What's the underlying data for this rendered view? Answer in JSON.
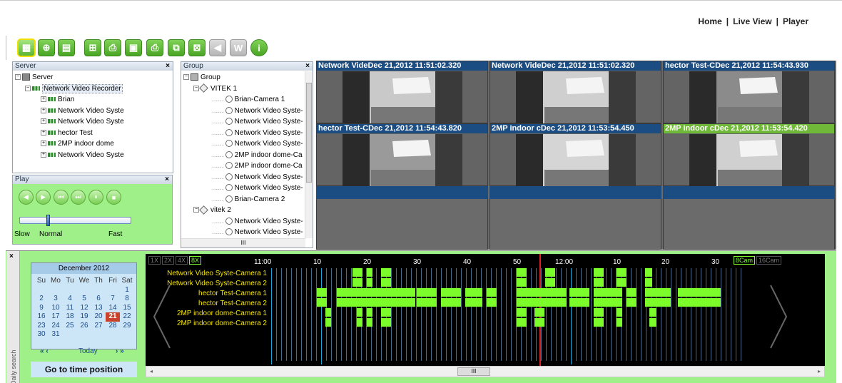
{
  "nav": {
    "home": "Home",
    "live": "Live View",
    "player": "Player",
    "sep": "|"
  },
  "server_panel": {
    "title": "Server",
    "close": "×",
    "root": "Server",
    "nvr": "Network Video Recorder",
    "children": [
      "Brian",
      "Network Video Syste",
      "Network Video Syste",
      "hector Test",
      "2MP indoor dome",
      "Network Video Syste"
    ]
  },
  "group_panel": {
    "title": "Group",
    "close": "×",
    "root": "Group",
    "group1": "VITEK 1",
    "cams1": [
      "Brian-Camera 1",
      "Network Video Syste-",
      "Network Video Syste-",
      "Network Video Syste-",
      "Network Video Syste-",
      "2MP indoor dome-Ca",
      "2MP indoor dome-Ca",
      "Network Video Syste-",
      "Network Video Syste-",
      "Brian-Camera 2"
    ],
    "group2": "vitek 2",
    "cams2": [
      "Network Video Syste-",
      "Network Video Syste-"
    ],
    "scroll": "III"
  },
  "play_panel": {
    "title": "Play",
    "close": "×",
    "slow": "Slow",
    "normal": "Normal",
    "fast": "Fast",
    "speed_level": 0.25
  },
  "cameras": [
    {
      "title": "Network VideDec 21,2012 11:51:02.320",
      "active": false
    },
    {
      "title": "Network VideDec 21,2012 11:51:02.320",
      "active": false
    },
    {
      "title": "hector Test-CDec 21,2012 11:54:43.930",
      "active": false
    },
    {
      "title": "hector Test-CDec 21,2012 11:54:43.820",
      "active": false
    },
    {
      "title": "2MP indoor cDec 21,2012 11:53:54.450",
      "active": false
    },
    {
      "title": "2MP indoor cDec 21,2012 11:53:54.420",
      "active": true
    }
  ],
  "calendar": {
    "month": "December 2012",
    "weekdays": [
      "Su",
      "Mo",
      "Tu",
      "We",
      "Th",
      "Fri",
      "Sat"
    ],
    "weeks": [
      [
        "",
        "",
        "",
        "",
        "",
        "",
        "1"
      ],
      [
        "2",
        "3",
        "4",
        "5",
        "6",
        "7",
        "8"
      ],
      [
        "9",
        "10",
        "11",
        "12",
        "13",
        "14",
        "15"
      ],
      [
        "16",
        "17",
        "18",
        "19",
        "20",
        "21",
        "22"
      ],
      [
        "23",
        "24",
        "25",
        "26",
        "27",
        "28",
        "29"
      ],
      [
        "30",
        "31",
        "",
        "",
        "",
        "",
        ""
      ]
    ],
    "selected": "21",
    "prev": "« ‹",
    "today": "Today",
    "next": "› »"
  },
  "goto": "Go to time position",
  "side_label": "Daily search",
  "side_close": "×",
  "timeline": {
    "zoom": [
      "1X",
      "2X",
      "4X",
      "8X"
    ],
    "zoom_active": "8X",
    "cam_modes": [
      "8Cam",
      "16Cam"
    ],
    "cam_mode_active": "8Cam",
    "hours": [
      "11:00",
      "10",
      "20",
      "30",
      "40",
      "50",
      "12:00",
      "10",
      "20",
      "30"
    ],
    "cameras": [
      "Network Video Syste-Camera 1",
      "Network Video Syste-Camera 2",
      "hector Test-Camera 1",
      "hector Test-Camera 2",
      "2MP indoor dome-Camera 1",
      "2MP indoor dome-Camera 2"
    ],
    "scroll": "III"
  },
  "colors": {
    "accent": "#7dfc2b",
    "header_blue": "#1b4d82",
    "panel_green": "#9ff089"
  }
}
